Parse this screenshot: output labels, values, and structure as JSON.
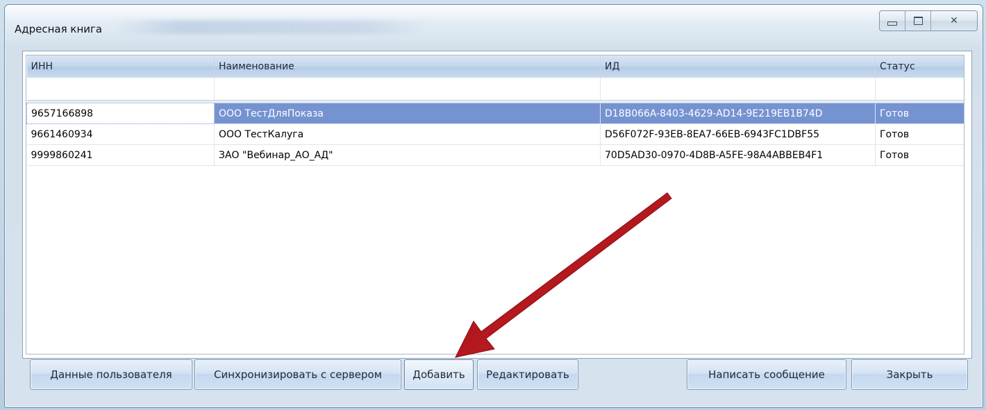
{
  "window": {
    "title": "Адресная книга",
    "close_glyph": "✕"
  },
  "table": {
    "columns": [
      "ИНН",
      "Наименование",
      "ИД",
      "Статус"
    ],
    "rows": [
      {
        "inn": "9657166898",
        "name": "ООО ТестДляПоказа",
        "id": "D18B066A-8403-4629-AD14-9E219EB1B74D",
        "status": "Готов",
        "selected": true
      },
      {
        "inn": "9661460934",
        "name": "ООО ТестКалуга",
        "id": "D56F072F-93EB-8EA7-66EB-6943FC1DBF55",
        "status": "Готов",
        "selected": false
      },
      {
        "inn": "9999860241",
        "name": "ЗАО \"Вебинар_АО_АД\"",
        "id": "70D5AD30-0970-4D8B-A5FE-98A4ABBEB4F1",
        "status": "Готов",
        "selected": false
      }
    ]
  },
  "buttons": {
    "user_data": "Данные пользователя",
    "sync": "Синхронизировать с сервером",
    "add": "Добавить",
    "edit": "Редактировать",
    "write_message": "Написать сообщение",
    "close": "Закрыть"
  },
  "colors": {
    "selection": "#7593d1",
    "arrow": "#b0141a"
  },
  "icons": [
    "minimize-icon",
    "maximize-icon",
    "close-icon",
    "pointer-arrow"
  ]
}
